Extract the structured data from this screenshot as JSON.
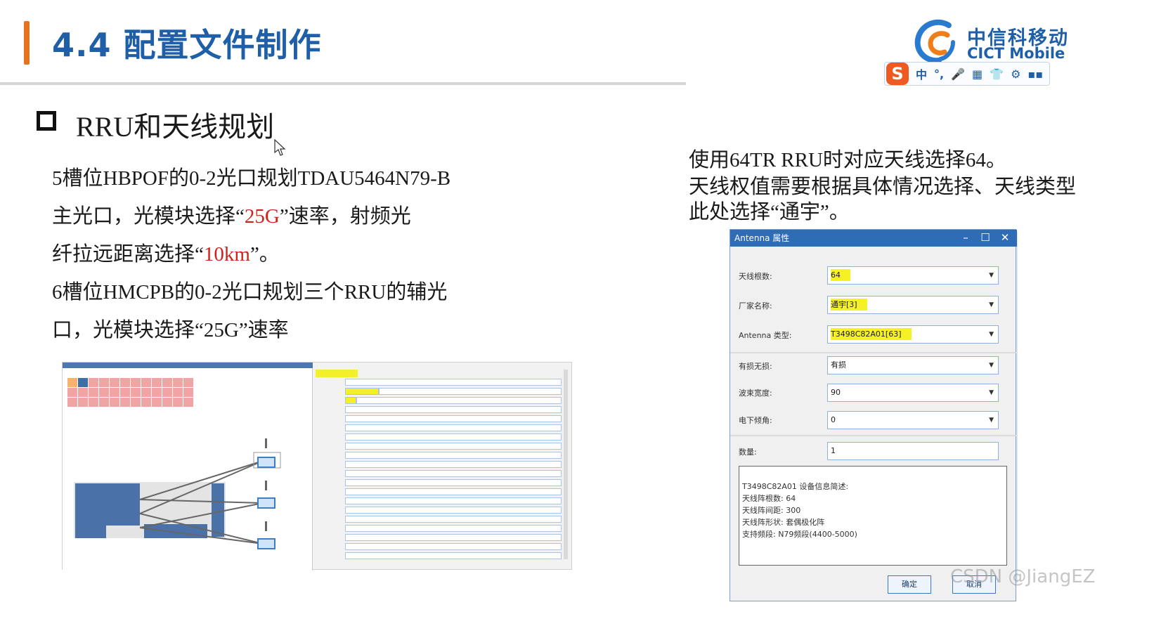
{
  "header": {
    "title": "4.4 配置文件制作",
    "logo_cn": "中信科移动",
    "logo_en": "CICT Mobile",
    "ime_items": [
      "中",
      "°,",
      "🎤",
      "▦",
      "👕",
      "⚙",
      "▪▪"
    ]
  },
  "section": {
    "title": "RRU和天线规划"
  },
  "left_text": {
    "line1": "5槽位HBPOF的0-2光口规划TDAU5464N79-B",
    "line2_a": "主光口，光模块选择“",
    "line2_red": "25G",
    "line2_b": "”速率，射频光",
    "line3_a": "纤拉远距离选择“",
    "line3_red": "10km",
    "line3_b": "”。",
    "line4": "6槽位HMCPB的0-2光口规划三个RRU的辅光",
    "line5": "口，光模块选择“25G”速率"
  },
  "right_text": {
    "line1": "使用64TR RRU时对应天线选择64。",
    "line2": "天线权值需要根据具体情况选择、天线类型",
    "line3": "此处选择“通宇”。"
  },
  "dialog": {
    "title": "Antenna 属性",
    "fields": [
      {
        "label": "天线根数:",
        "value": "64",
        "highlight": true
      },
      {
        "label": "厂家名称:",
        "value": "通宇[3]",
        "highlight": true
      },
      {
        "label": "Antenna 类型:",
        "value": "T3498C82A01[63]",
        "highlight": true
      },
      {
        "label": "有损无损:",
        "value": "有损",
        "highlight": false
      },
      {
        "label": "波束宽度:",
        "value": "90",
        "highlight": false
      },
      {
        "label": "电下倾角:",
        "value": "0",
        "highlight": false
      }
    ],
    "quantity_label": "数量:",
    "quantity_value": "1",
    "info_lines": [
      "T3498C82A01 设备信息简述:",
      "天线阵根数: 64",
      "天线阵间距: 300",
      "天线阵形状: 套偶极化阵",
      "支持频段: N79频段(4400-5000)"
    ],
    "ok_label": "确定",
    "cancel_label": "取消"
  },
  "watermark": "CSDN @JiangEZ",
  "colors": {
    "title_blue": "#1f5fa8",
    "accent_orange": "#e8731e",
    "highlight_red": "#d0221b",
    "highlight_yellow": "#f6f126"
  }
}
